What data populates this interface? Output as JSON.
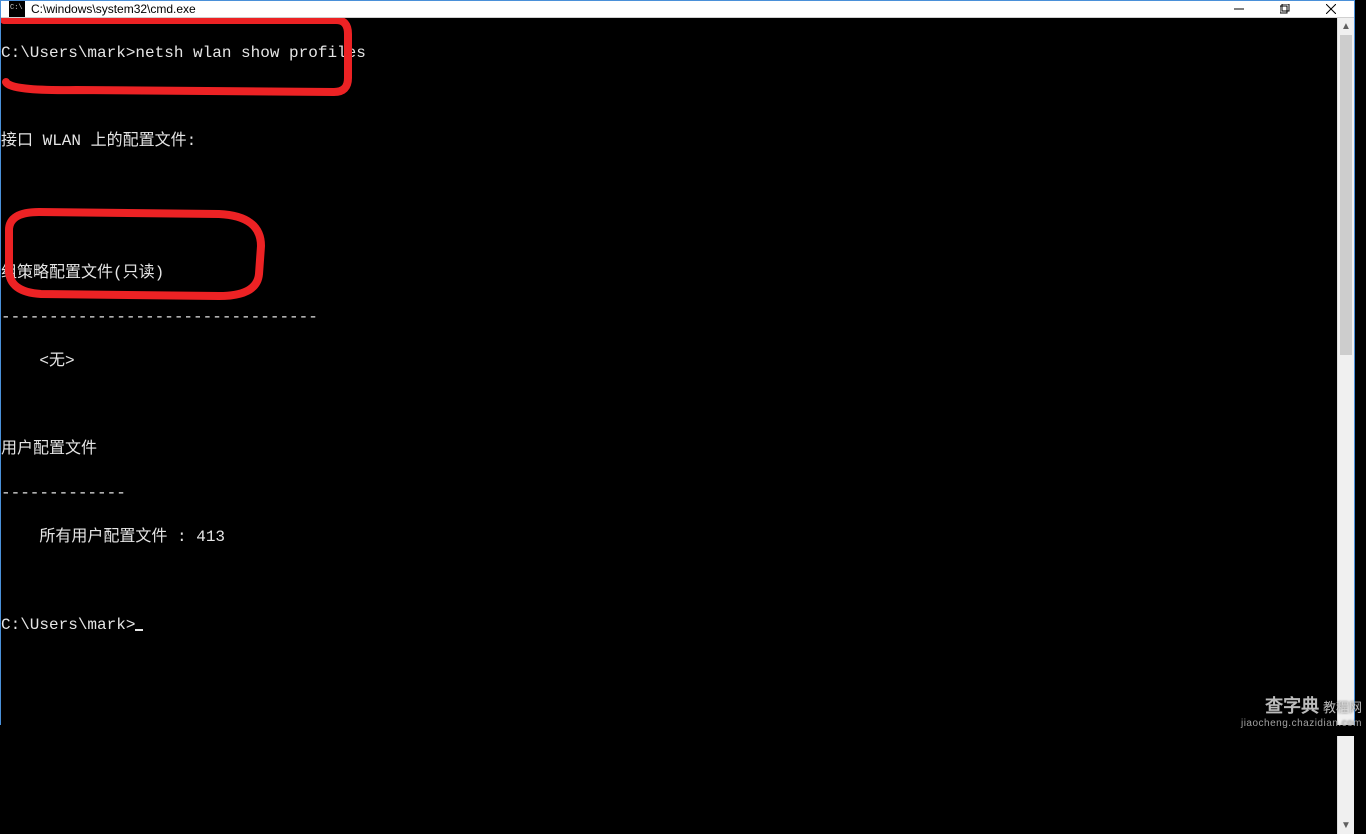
{
  "window": {
    "title": "C:\\windows\\system32\\cmd.exe"
  },
  "terminal": {
    "prompt1": "C:\\Users\\mark>",
    "command1": "netsh wlan show profiles",
    "blank1": "",
    "interface_heading": "接口 WLAN 上的配置文件:",
    "blank2": "",
    "group_policy_heading": "组策略配置文件(只读)",
    "dashes1": "---------------------------------",
    "none_entry": "    <无>",
    "blank3": "",
    "user_profiles_heading": "用户配置文件",
    "dashes2": "-------------",
    "profile_entry": "    所有用户配置文件 : 413",
    "blank4": "",
    "prompt2": "C:\\Users\\mark>"
  },
  "watermark": {
    "brand_cn": "查字典",
    "brand_suffix": "教程网",
    "url": "jiaocheng.chazidian.com"
  }
}
